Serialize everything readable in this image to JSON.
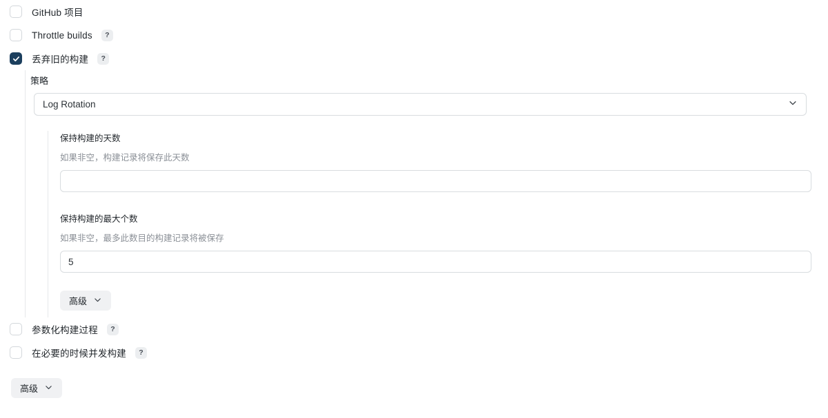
{
  "form": {
    "checkboxes_top": [
      {
        "id": "github-project",
        "label": "GitHub 项目",
        "checked": false,
        "help": false,
        "help_glyph": "?"
      },
      {
        "id": "throttle-builds",
        "label": "Throttle builds",
        "checked": false,
        "help": true,
        "help_glyph": "?"
      },
      {
        "id": "discard-old-builds",
        "label": "丢弃旧的构建",
        "checked": true,
        "help": true,
        "help_glyph": "?"
      }
    ],
    "discard_section": {
      "strategy_label": "策略",
      "strategy_value": "Log Rotation",
      "strategy_options": [
        "Log Rotation"
      ],
      "chevron_icon": "chevron-down-icon",
      "fields": [
        {
          "id": "days-to-keep",
          "title": "保持构建的天数",
          "description": "如果非空，构建记录将保存此天数",
          "value": "",
          "placeholder": ""
        },
        {
          "id": "max-builds-to-keep",
          "title": "保持构建的最大个数",
          "description": "如果非空，最多此数目的构建记录将被保存",
          "value": "5",
          "placeholder": ""
        }
      ],
      "advanced_button": {
        "label": "高级",
        "chevron_icon": "chevron-down-icon"
      }
    },
    "checkboxes_bottom": [
      {
        "id": "parameterized-build",
        "label": "参数化构建过程",
        "checked": false,
        "help": true,
        "help_glyph": "?"
      },
      {
        "id": "concurrent-builds",
        "label": "在必要的时候并发构建",
        "checked": false,
        "help": true,
        "help_glyph": "?"
      }
    ],
    "advanced_button": {
      "label": "高级",
      "chevron_icon": "chevron-down-icon"
    }
  },
  "colors": {
    "checkbox_checked": "#1c3f5e",
    "border": "#d8dcdf",
    "guide_line": "#e6e8ea",
    "text": "#23282d",
    "muted_text": "#8b9097",
    "pill_bg": "#f0f1f3",
    "help_bg": "#eceef0",
    "background": "#ffffff"
  }
}
